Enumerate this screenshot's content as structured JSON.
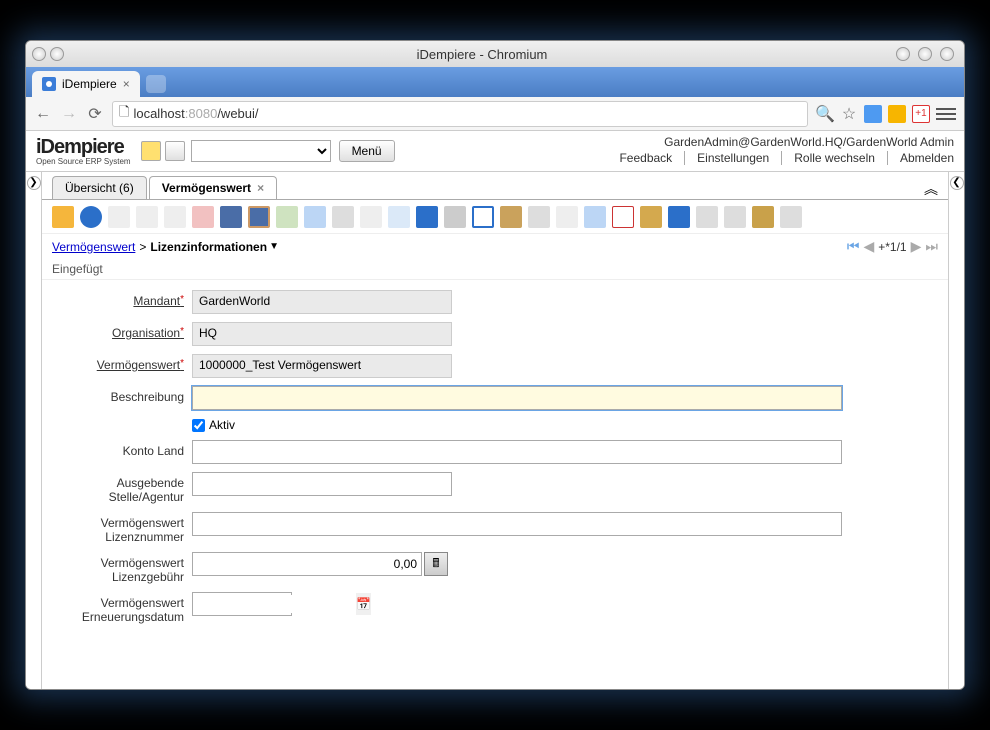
{
  "window": {
    "title": "iDempiere - Chromium"
  },
  "browser": {
    "tab_title": "iDempiere",
    "url_host": "localhost",
    "url_port": ":8080",
    "url_path": "/webui/"
  },
  "header": {
    "logo_main": "iDempiere",
    "logo_sub": "Open  Source   ERP  System",
    "menu_label": "Menü",
    "user_context": "GardenAdmin@GardenWorld.HQ/GardenWorld Admin",
    "links": {
      "feedback": "Feedback",
      "settings": "Einstellungen",
      "role": "Rolle wechseln",
      "logout": "Abmelden"
    }
  },
  "tabs": {
    "overview": "Übersicht (6)",
    "asset": "Vermögenswert"
  },
  "breadcrumb": {
    "root": "Vermögenswert",
    "current": "Lizenzinformationen",
    "record": "+*1/1"
  },
  "status": "Eingefügt",
  "form": {
    "labels": {
      "client": "Mandant",
      "org": "Organisation",
      "asset": "Vermögenswert",
      "description": "Beschreibung",
      "active": "Aktiv",
      "country": "Konto Land",
      "agency": "Ausgebende Stelle/Agentur",
      "licno": "Vermögenswert Lizenznummer",
      "licfee": "Vermögenswert Lizenzgebühr",
      "renew": "Vermögenswert Erneuerungsdatum"
    },
    "values": {
      "client": "GardenWorld",
      "org": "HQ",
      "asset": "1000000_Test Vermögenswert",
      "description": "",
      "active": true,
      "country": "",
      "agency": "",
      "licno": "",
      "licfee": "0,00",
      "renew": ""
    }
  }
}
